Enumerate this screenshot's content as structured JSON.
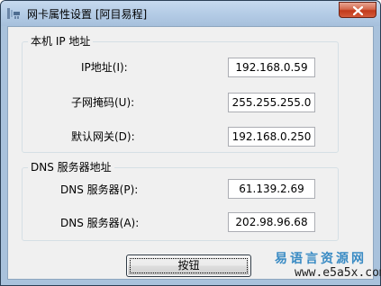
{
  "window": {
    "title": "网卡属性设置 [阿目易程]",
    "close_icon": "close-icon",
    "app_icon": "network-card-icon"
  },
  "group_ip": {
    "title": "本机 IP 地址",
    "rows": [
      {
        "label": "IP地址(I):",
        "value": "192.168.0.59"
      },
      {
        "label": "子网掩码(U):",
        "value": "255.255.255.0"
      },
      {
        "label": "默认网关(D):",
        "value": "192.168.0.250"
      }
    ]
  },
  "group_dns": {
    "title": "DNS 服务器地址",
    "rows": [
      {
        "label": "DNS 服务器(P):",
        "value": "61.139.2.69"
      },
      {
        "label": "DNS 服务器(A):",
        "value": "202.98.96.68"
      }
    ]
  },
  "button": {
    "label": "按钮"
  },
  "watermark": {
    "text": "易语言资源网",
    "url": "www.e5a5x.com"
  },
  "colors": {
    "title_bar": "#b3cbe5",
    "close_button": "#c2391a",
    "dialog_bg": "#f0f0f0",
    "watermark": "#3a8bc4"
  }
}
